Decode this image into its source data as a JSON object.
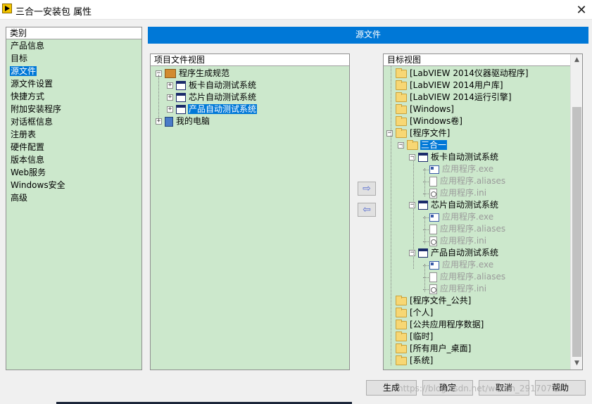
{
  "window": {
    "title": "三合一安装包 属性",
    "close_label": "✕"
  },
  "category": {
    "header": "类别",
    "items": [
      {
        "label": "产品信息",
        "selected": false
      },
      {
        "label": "目标",
        "selected": false
      },
      {
        "label": "源文件",
        "selected": true
      },
      {
        "label": "源文件设置",
        "selected": false
      },
      {
        "label": "快捷方式",
        "selected": false
      },
      {
        "label": "附加安装程序",
        "selected": false
      },
      {
        "label": "对话框信息",
        "selected": false
      },
      {
        "label": "注册表",
        "selected": false
      },
      {
        "label": "硬件配置",
        "selected": false
      },
      {
        "label": "版本信息",
        "selected": false
      },
      {
        "label": "Web服务",
        "selected": false
      },
      {
        "label": "Windows安全",
        "selected": false
      },
      {
        "label": "高级",
        "selected": false
      }
    ]
  },
  "section_title": "源文件",
  "project_view": {
    "header": "项目文件视图",
    "items": [
      {
        "label": "程序生成规范",
        "level": 0,
        "icon": "build-spec-icon",
        "expander": "minus",
        "selected": false
      },
      {
        "label": "板卡自动测试系统",
        "level": 1,
        "icon": "vi-icon",
        "expander": "plus",
        "selected": false
      },
      {
        "label": "芯片自动测试系统",
        "level": 1,
        "icon": "vi-icon",
        "expander": "plus",
        "selected": false
      },
      {
        "label": "产品自动测试系统",
        "level": 1,
        "icon": "vi-icon",
        "expander": "plus",
        "selected": true
      },
      {
        "label": "我的电脑",
        "level": 0,
        "icon": "computer-icon",
        "expander": "plus",
        "selected": false
      }
    ]
  },
  "transfer": {
    "add_icon": "right-arrow-icon",
    "remove_icon": "left-arrow-icon",
    "add_glyph": "⇨",
    "remove_glyph": "⇦"
  },
  "target_view": {
    "header": "目标视图",
    "items": [
      {
        "label": "[LabVIEW 2014仪器驱动程序]",
        "level": 0,
        "icon": "folder-icon",
        "expander": "none"
      },
      {
        "label": "[LabVIEW 2014用户库]",
        "level": 0,
        "icon": "folder-icon",
        "expander": "none"
      },
      {
        "label": "[LabVIEW 2014运行引擎]",
        "level": 0,
        "icon": "folder-icon",
        "expander": "none"
      },
      {
        "label": "[Windows]",
        "level": 0,
        "icon": "folder-icon",
        "expander": "none"
      },
      {
        "label": "[Windows卷]",
        "level": 0,
        "icon": "folder-icon",
        "expander": "none"
      },
      {
        "label": "[程序文件]",
        "level": 0,
        "icon": "folder-icon",
        "expander": "minus"
      },
      {
        "label": "三合一",
        "level": 1,
        "icon": "folder-open-icon",
        "expander": "minus",
        "selected": true
      },
      {
        "label": "板卡自动测试系统",
        "level": 2,
        "icon": "vi-icon",
        "expander": "minus"
      },
      {
        "label": "应用程序.exe",
        "level": 3,
        "icon": "exe-icon",
        "expander": "none",
        "dim": true
      },
      {
        "label": "应用程序.aliases",
        "level": 3,
        "icon": "file-icon",
        "expander": "none",
        "dim": true
      },
      {
        "label": "应用程序.ini",
        "level": 3,
        "icon": "ini-icon",
        "expander": "none",
        "dim": true
      },
      {
        "label": "芯片自动测试系统",
        "level": 2,
        "icon": "vi-icon",
        "expander": "minus"
      },
      {
        "label": "应用程序.exe",
        "level": 3,
        "icon": "exe-icon",
        "expander": "none",
        "dim": true
      },
      {
        "label": "应用程序.aliases",
        "level": 3,
        "icon": "file-icon",
        "expander": "none",
        "dim": true
      },
      {
        "label": "应用程序.ini",
        "level": 3,
        "icon": "ini-icon",
        "expander": "none",
        "dim": true
      },
      {
        "label": "产品自动测试系统",
        "level": 2,
        "icon": "vi-icon",
        "expander": "minus"
      },
      {
        "label": "应用程序.exe",
        "level": 3,
        "icon": "exe-icon",
        "expander": "none",
        "dim": true
      },
      {
        "label": "应用程序.aliases",
        "level": 3,
        "icon": "file-icon",
        "expander": "none",
        "dim": true
      },
      {
        "label": "应用程序.ini",
        "level": 3,
        "icon": "ini-icon",
        "expander": "none",
        "dim": true
      },
      {
        "label": "[程序文件_公共]",
        "level": 0,
        "icon": "folder-icon",
        "expander": "none"
      },
      {
        "label": "[个人]",
        "level": 0,
        "icon": "folder-icon",
        "expander": "none"
      },
      {
        "label": "[公共应用程序数据]",
        "level": 0,
        "icon": "folder-icon",
        "expander": "none"
      },
      {
        "label": "[临时]",
        "level": 0,
        "icon": "folder-icon",
        "expander": "none"
      },
      {
        "label": "[所有用户_桌面]",
        "level": 0,
        "icon": "folder-icon",
        "expander": "none"
      },
      {
        "label": "[系统]",
        "level": 0,
        "icon": "folder-icon",
        "expander": "none"
      }
    ],
    "scroll": {
      "up_glyph": "▲",
      "down_glyph": "▼"
    }
  },
  "buttons": {
    "build": "生成",
    "ok": "确定",
    "cancel": "取消",
    "help": "帮助"
  },
  "watermark": "https://blog.csdn.net/weixin_29170711",
  "colors": {
    "accent": "#0078d7",
    "panel_bg": "#cce8cc"
  }
}
